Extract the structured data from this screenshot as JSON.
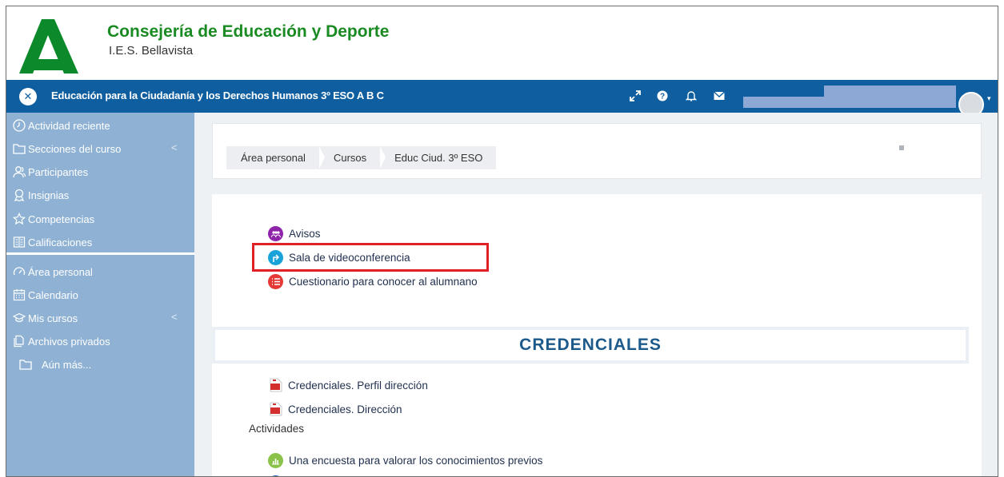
{
  "brand": {
    "title": "Consejería de Educación y Deporte",
    "subtitle": "I.E.S. Bellavista",
    "logo_icon": "junta-andalucia-logo"
  },
  "navbar": {
    "close_icon": "close-icon",
    "course_title": "Educación para la Ciudadanía y los Derechos Humanos 3º ESO A B C",
    "icons": [
      "expand-icon",
      "help-icon",
      "bell-icon",
      "envelope-icon"
    ],
    "user_caret": "▾"
  },
  "sidebar": {
    "items": [
      {
        "label": "Actividad reciente",
        "icon": "clock-icon"
      },
      {
        "label": "Secciones del curso",
        "icon": "folder-icon",
        "caret": "<"
      },
      {
        "label": "Participantes",
        "icon": "users-icon"
      },
      {
        "label": "Insignias",
        "icon": "badge-icon"
      },
      {
        "label": "Competencias",
        "icon": "star-icon"
      },
      {
        "label": "Calificaciones",
        "icon": "gradebook-icon"
      },
      {
        "label": "Área personal",
        "icon": "dashboard-icon"
      },
      {
        "label": "Calendario",
        "icon": "calendar-icon"
      },
      {
        "label": "Mis cursos",
        "icon": "graduation-cap-icon",
        "caret": "<"
      },
      {
        "label": "Archivos privados",
        "icon": "files-icon"
      },
      {
        "label": "Aún más...",
        "icon": "folder-icon"
      }
    ]
  },
  "breadcrumb": {
    "items": [
      "Área personal",
      "Cursos",
      "Educ Ciud. 3º ESO"
    ]
  },
  "activities_top": [
    {
      "label": "Avisos",
      "icon": "forum-icon",
      "color": "#8e24aa",
      "highlighted": false
    },
    {
      "label": "Sala de videoconferencia",
      "icon": "url-icon",
      "color": "#1aa3d8",
      "highlighted": true
    },
    {
      "label": "Cuestionario para conocer al alumnano",
      "icon": "quiz-icon",
      "color": "#e53935",
      "highlighted": false
    }
  ],
  "section": {
    "title": "CREDENCIALES"
  },
  "resources": [
    {
      "label": "Credenciales. Perfil dirección",
      "icon": "pdf-icon"
    },
    {
      "label": "Credenciales. Dirección",
      "icon": "pdf-icon"
    }
  ],
  "activities_label": "Actividades",
  "activities_bottom": [
    {
      "label": "Una encuesta para valorar los conocimientos previos",
      "icon": "survey-icon",
      "color": "#8bc34a"
    }
  ],
  "colors": {
    "brand_green": "#1a8a22",
    "navbar": "#0f5fa0",
    "sidebar": "#8fb2d4",
    "highlight": "#e02027",
    "section_title": "#1d5a8c"
  }
}
